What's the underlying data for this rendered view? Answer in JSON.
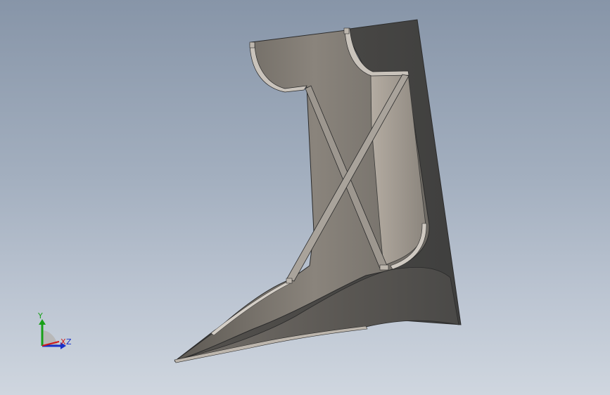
{
  "viewport": {
    "background_top": "#8795a8",
    "background_bottom": "#cfd6df"
  },
  "model": {
    "kind": "3d-part",
    "shade_dark": "#4d4d4b",
    "shade_mid": "#6d6963",
    "shade_light": "#a39d96",
    "edge_color": "#2b2b2b"
  },
  "triad": {
    "x_label": "X",
    "y_label": "Y",
    "z_label": "Z",
    "x_color": "#d01818",
    "y_color": "#18a018",
    "z_color": "#1830c8"
  }
}
